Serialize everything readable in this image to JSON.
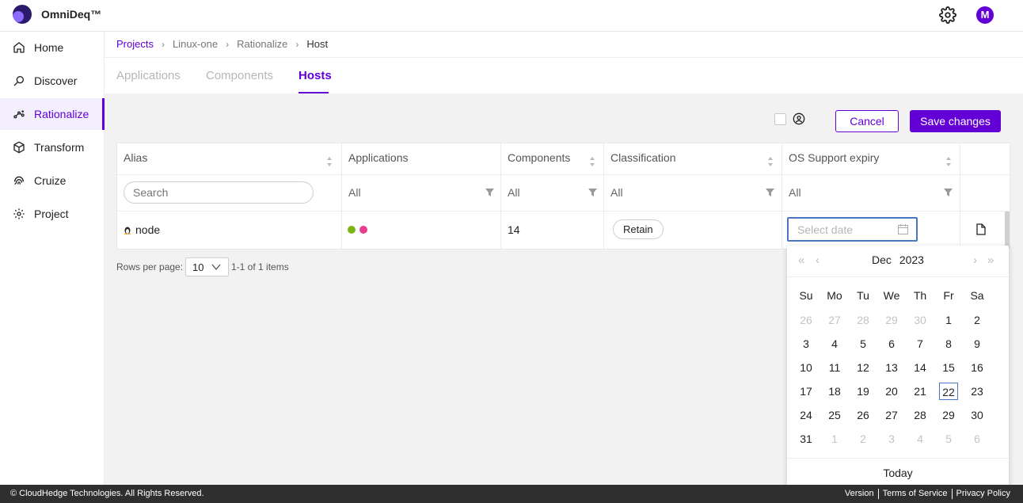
{
  "app": {
    "name": "OmniDeq™",
    "avatar_initial": "M",
    "accent": "#6200d6"
  },
  "sidebar": {
    "items": [
      {
        "label": "Home",
        "icon": "home-icon"
      },
      {
        "label": "Discover",
        "icon": "discover-icon"
      },
      {
        "label": "Rationalize",
        "icon": "rationalize-icon",
        "active": true
      },
      {
        "label": "Transform",
        "icon": "cube-icon"
      },
      {
        "label": "Cruize",
        "icon": "fingerprint-icon"
      },
      {
        "label": "Project",
        "icon": "gear-icon"
      }
    ]
  },
  "breadcrumb": [
    "Projects",
    "Linux-one",
    "Rationalize",
    "Host"
  ],
  "tabs": [
    {
      "label": "Applications"
    },
    {
      "label": "Components"
    },
    {
      "label": "Hosts",
      "active": true
    }
  ],
  "actions": {
    "cancel": "Cancel",
    "save": "Save changes"
  },
  "table": {
    "columns": [
      "Alias",
      "Applications",
      "Components",
      "Classification",
      "OS Support expiry"
    ],
    "search_placeholder": "Search",
    "filter_all": "All",
    "rows": [
      {
        "alias": "node",
        "applications_dots": [
          "#7cb518",
          "#e83e8c"
        ],
        "components": "14",
        "classification": "Retain",
        "date_placeholder": "Select date"
      }
    ]
  },
  "pagination": {
    "rows_label": "Rows per page:",
    "rows_value": "10",
    "range": "1-1 of 1 items"
  },
  "calendar": {
    "month": "Dec",
    "year": "2023",
    "weekdays": [
      "Su",
      "Mo",
      "Tu",
      "We",
      "Th",
      "Fr",
      "Sa"
    ],
    "weeks": [
      [
        "26",
        "27",
        "28",
        "29",
        "30",
        "1",
        "2"
      ],
      [
        "3",
        "4",
        "5",
        "6",
        "7",
        "8",
        "9"
      ],
      [
        "10",
        "11",
        "12",
        "13",
        "14",
        "15",
        "16"
      ],
      [
        "17",
        "18",
        "19",
        "20",
        "21",
        "22",
        "23"
      ],
      [
        "24",
        "25",
        "26",
        "27",
        "28",
        "29",
        "30"
      ],
      [
        "31",
        "1",
        "2",
        "3",
        "4",
        "5",
        "6"
      ]
    ],
    "selected": "22",
    "today_label": "Today"
  },
  "footer": {
    "copyright": "© CloudHedge Technologies. All Rights Reserved.",
    "links": [
      "Version",
      "Terms of Service",
      "Privacy Policy"
    ]
  }
}
